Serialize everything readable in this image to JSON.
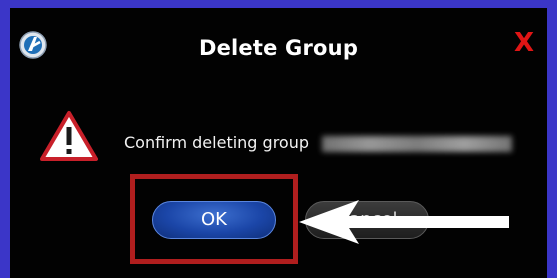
{
  "dialog": {
    "title": "Delete Group",
    "close_label": "X",
    "message": "Confirm deleting group",
    "group_name_obscured": true
  },
  "buttons": {
    "ok_label": "OK",
    "cancel_label": "Cancel"
  },
  "icons": {
    "app": "app-logo-icon",
    "close": "close-icon",
    "warning": "warning-icon",
    "arrow": "arrow-left-icon"
  },
  "colors": {
    "frame": "#3b36c8",
    "dialog_background": "#020202",
    "close": "#e01515",
    "ok_button": "#1b46a8",
    "highlight": "#b01e1e",
    "warning_border": "#c8202a"
  }
}
